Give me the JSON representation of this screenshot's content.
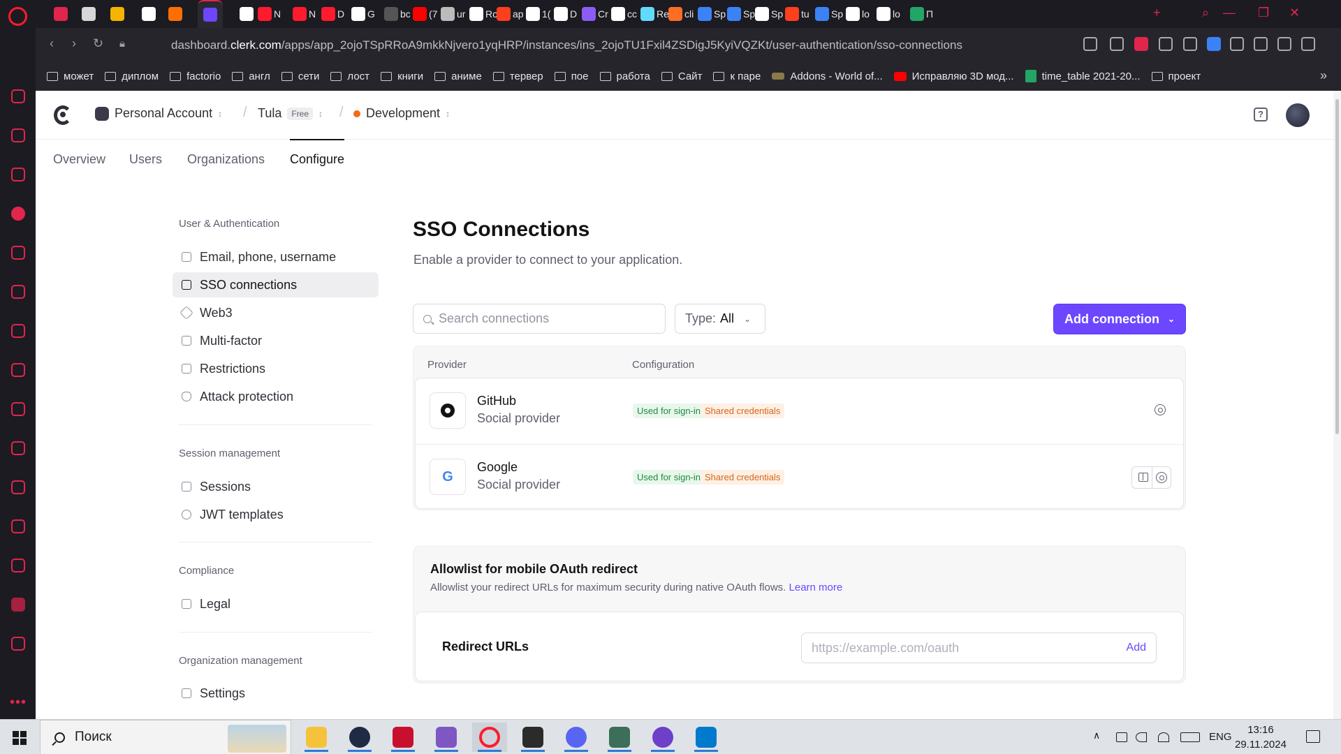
{
  "browser": {
    "tabs": [
      {
        "label": "",
        "icon": "gamepad-icon",
        "color": "#e2254c"
      },
      {
        "label": "",
        "icon": "v-icon",
        "color": "#d7d7d7"
      },
      {
        "label": "",
        "icon": "drive-icon",
        "color": "#f4b400"
      },
      {
        "label": "",
        "icon": "github-icon",
        "color": "#ffffff"
      },
      {
        "label": "",
        "icon": "opera-icon",
        "color": "#ff6f00"
      },
      {
        "label": "",
        "icon": "clerk-icon",
        "color": "#6c47ff",
        "active": true
      },
      {
        "label": "",
        "icon": "x-icon",
        "color": "#ffffff"
      },
      {
        "label": "N",
        "icon": "opera-icon",
        "color": "#ff1b2d"
      },
      {
        "label": "N",
        "icon": "opera-icon",
        "color": "#ff1b2d"
      },
      {
        "label": "D",
        "icon": "note-icon",
        "color": "#ff1b2d"
      },
      {
        "label": "G",
        "icon": "x-icon",
        "color": "#ffffff"
      },
      {
        "label": "bc",
        "icon": "bp-icon",
        "color": "#555555"
      },
      {
        "label": "(7",
        "icon": "youtube-icon",
        "color": "#ff0000"
      },
      {
        "label": "ur",
        "icon": "gear-icon",
        "color": "#bbbbbb"
      },
      {
        "label": "Rc",
        "icon": "n-icon",
        "color": "#ffffff"
      },
      {
        "label": "ар",
        "icon": "yandex-icon",
        "color": "#fc3f1d"
      },
      {
        "label": "1(",
        "icon": "puzzle-icon",
        "color": "#ffffff"
      },
      {
        "label": "D",
        "icon": "w-icon",
        "color": "#ffffff"
      },
      {
        "label": "Cr",
        "icon": "sparkle-icon",
        "color": "#8b5cf6"
      },
      {
        "label": "cc",
        "icon": "copilot-icon",
        "color": "#ffffff"
      },
      {
        "label": "Re",
        "icon": "react-icon",
        "color": "#61dafb"
      },
      {
        "label": "cli",
        "icon": "gitlab-icon",
        "color": "#fc6d26"
      },
      {
        "label": "Sp",
        "icon": "feather-icon",
        "color": "#3b82f6"
      },
      {
        "label": "Sp",
        "icon": "cube-icon",
        "color": "#3b82f6"
      },
      {
        "label": "Sp",
        "icon": "globe-icon",
        "color": "#ffffff"
      },
      {
        "label": "tu",
        "icon": "yandex-icon",
        "color": "#fc3f1d"
      },
      {
        "label": "Sp",
        "icon": "cube-icon",
        "color": "#3b82f6"
      },
      {
        "label": "lo",
        "icon": "triangle-icon",
        "color": "#ffffff"
      },
      {
        "label": "lo",
        "icon": "triangle-icon",
        "color": "#ffffff"
      },
      {
        "label": "П",
        "icon": "sheets-icon",
        "color": "#23a566"
      }
    ],
    "url_prefix": "dashboard.",
    "url_host": "clerk.com",
    "url_path": "/apps/app_2ojoTSpRRoA9mkkNjvero1yqHRP/instances/ins_2ojoTU1Fxil4ZSDigJ5KyiVQZKt/user-authentication/sso-connections",
    "bookmarks": [
      {
        "label": "может",
        "icon": "folder-icon"
      },
      {
        "label": "диплом",
        "icon": "folder-icon"
      },
      {
        "label": "factorio",
        "icon": "folder-icon"
      },
      {
        "label": "англ",
        "icon": "folder-icon"
      },
      {
        "label": "сети",
        "icon": "folder-icon"
      },
      {
        "label": "лост",
        "icon": "folder-icon"
      },
      {
        "label": "книги",
        "icon": "folder-icon"
      },
      {
        "label": "аниме",
        "icon": "folder-icon"
      },
      {
        "label": "тервер",
        "icon": "folder-icon"
      },
      {
        "label": "пое",
        "icon": "folder-icon"
      },
      {
        "label": "работа",
        "icon": "folder-icon"
      },
      {
        "label": "Сайт",
        "icon": "folder-icon"
      },
      {
        "label": "к паре",
        "icon": "folder-icon"
      },
      {
        "label": "Addons - World of...",
        "icon": "tank-icon"
      },
      {
        "label": "Исправляю 3D мод...",
        "icon": "youtube-icon"
      },
      {
        "label": "time_table 2021-20...",
        "icon": "sheets-icon"
      },
      {
        "label": "проект",
        "icon": "folder-icon"
      }
    ]
  },
  "app": {
    "account": "Personal Account",
    "app_name": "Tula",
    "plan_badge": "Free",
    "instance": "Development",
    "help_icon": "?",
    "subnav": [
      "Overview",
      "Users",
      "Organizations",
      "Configure"
    ],
    "sidebar": {
      "sections": [
        {
          "title": "User & Authentication",
          "items": [
            {
              "label": "Email, phone, username",
              "icon": "fingerprint-icon"
            },
            {
              "label": "SSO connections",
              "icon": "sso-icon",
              "active": true
            },
            {
              "label": "Web3",
              "icon": "web3-icon"
            },
            {
              "label": "Multi-factor",
              "icon": "asterisk-icon"
            },
            {
              "label": "Restrictions",
              "icon": "lock-icon"
            },
            {
              "label": "Attack protection",
              "icon": "shield-icon"
            }
          ]
        },
        {
          "title": "Session management",
          "items": [
            {
              "label": "Sessions",
              "icon": "sessions-icon"
            },
            {
              "label": "JWT templates",
              "icon": "jwt-icon"
            }
          ]
        },
        {
          "title": "Compliance",
          "items": [
            {
              "label": "Legal",
              "icon": "scale-icon"
            }
          ]
        },
        {
          "title": "Organization management",
          "items": [
            {
              "label": "Settings",
              "icon": "building-icon"
            }
          ]
        }
      ]
    },
    "main": {
      "title": "SSO Connections",
      "subtitle": "Enable a provider to connect to your application.",
      "search_placeholder": "Search connections",
      "type_label": "Type:",
      "type_value": "All",
      "add_button": "Add connection",
      "table": {
        "columns": [
          "Provider",
          "Configuration"
        ],
        "rows": [
          {
            "name": "GitHub",
            "type": "Social provider",
            "icon": "github-icon",
            "tags": [
              "Used for sign-in",
              "Shared credentials"
            ]
          },
          {
            "name": "Google",
            "type": "Social provider",
            "icon": "google-icon",
            "tags": [
              "Used for sign-in",
              "Shared credentials"
            ]
          }
        ]
      },
      "allowlist": {
        "title": "Allowlist for mobile OAuth redirect",
        "description": "Allowlist your redirect URLs for maximum security during native OAuth flows.",
        "learn_more": "Learn more",
        "redirect_label": "Redirect URLs",
        "redirect_placeholder": "https://example.com/oauth",
        "add_label": "Add"
      }
    }
  },
  "taskbar": {
    "search_label": "Поиск",
    "apps": [
      {
        "name": "file-explorer",
        "color": "#f5c33b"
      },
      {
        "name": "browser",
        "color": "#1f2a44"
      },
      {
        "name": "rider",
        "color": "#c8102e"
      },
      {
        "name": "visual-studio",
        "color": "#7e57c2"
      },
      {
        "name": "opera",
        "color": "#ff1b2d"
      },
      {
        "name": "app-game",
        "color": "#2b2b2b"
      },
      {
        "name": "discord",
        "color": "#5865f2"
      },
      {
        "name": "terminal",
        "color": "#3c6e5a"
      },
      {
        "name": "github-desktop",
        "color": "#6e40c9"
      },
      {
        "name": "vscode",
        "color": "#007acc"
      }
    ],
    "language": "ENG",
    "time": "13:16",
    "date": "29.11.2024"
  },
  "colors": {
    "accent": "#6c47ff",
    "opera_red": "#e2254c",
    "tag_green_text": "#1f8a3f",
    "tag_orange_text": "#d6661c"
  }
}
